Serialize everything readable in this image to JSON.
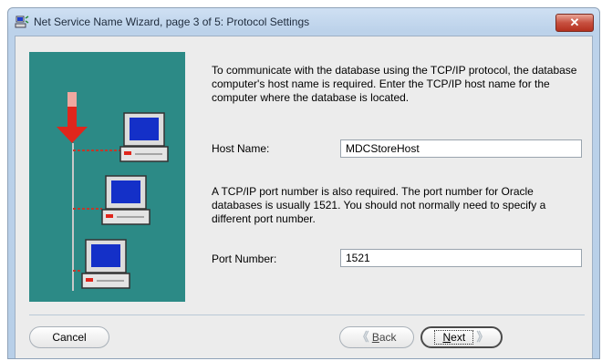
{
  "window": {
    "title": "Net Service Name Wizard, page 3 of 5: Protocol Settings",
    "close_glyph": "✕"
  },
  "content": {
    "intro": "To communicate with the database using the TCP/IP protocol, the database computer's host name is required.  Enter the TCP/IP host name for the computer where the database is located.",
    "host_label": "Host Name:",
    "host_value": "MDCStoreHost",
    "port_intro": "A TCP/IP port number is also required.  The port number for Oracle databases is usually 1521.  You should not normally need to specify a different port number.",
    "port_label": "Port Number:",
    "port_value": "1521"
  },
  "buttons": {
    "cancel": "Cancel",
    "back_mnemonic": "B",
    "back_rest": "ack",
    "next_mnemonic": "N",
    "next_rest": "ext",
    "back_arrow": "《",
    "next_arrow": "》"
  },
  "icons": {
    "title": "network-computer-icon",
    "illustration": "network-computers-illustration"
  },
  "colors": {
    "illustration_bg": "#2c8a86",
    "arrow": "#e0261c",
    "screen": "#1430c8"
  }
}
